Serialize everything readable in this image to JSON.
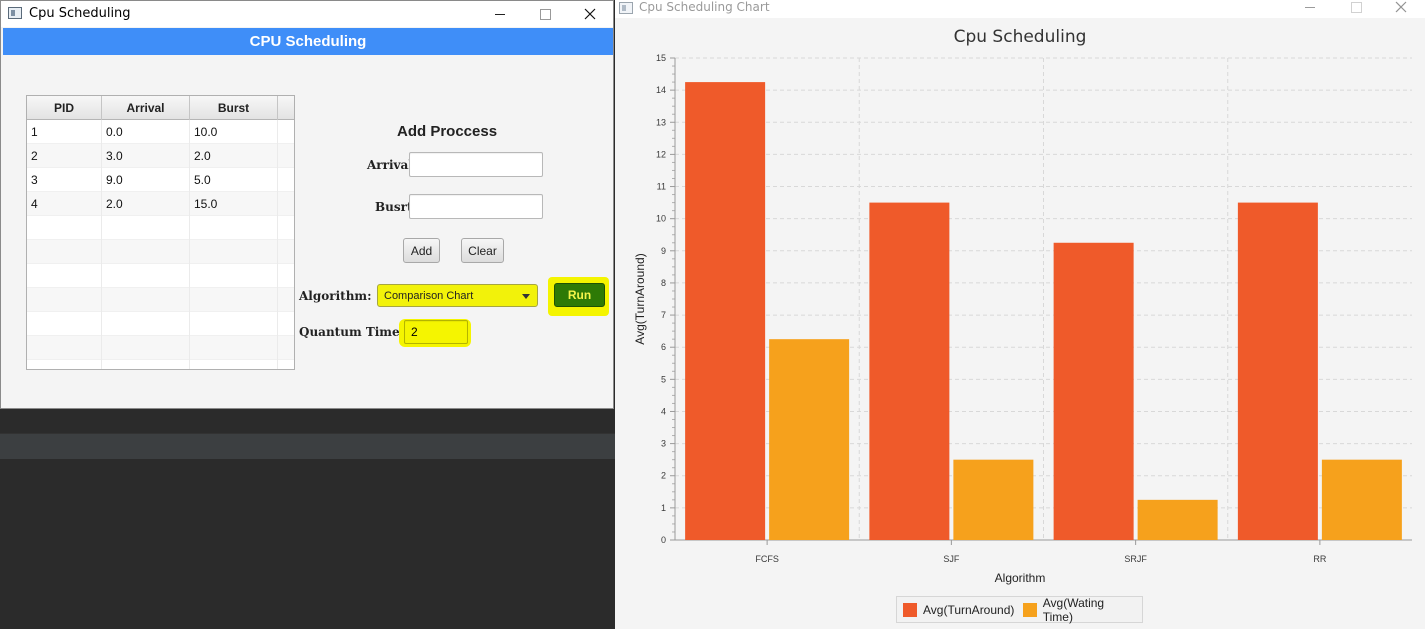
{
  "main_window": {
    "title": "Cpu Scheduling",
    "banner": "CPU Scheduling",
    "table": {
      "columns": [
        "PID",
        "Arrival",
        "Burst"
      ],
      "rows": [
        [
          "1",
          "0.0",
          "10.0"
        ],
        [
          "2",
          "3.0",
          "2.0"
        ],
        [
          "3",
          "9.0",
          "5.0"
        ],
        [
          "4",
          "2.0",
          "15.0"
        ]
      ]
    },
    "form": {
      "heading": "Add Proccess",
      "arrival_label": "Arrival:",
      "arrival_value": "",
      "burst_label": "Busrt:",
      "burst_value": "",
      "add_label": "Add",
      "clear_label": "Clear",
      "algorithm_label": "Algorithm:",
      "algorithm_selected": "Comparison Chart",
      "run_label": "Run",
      "quantum_label": "Quantum Time:",
      "quantum_value": "2"
    }
  },
  "chart_window": {
    "title": "Cpu Scheduling Chart"
  },
  "colors": {
    "turnaround": "#ef5a2a",
    "waiting": "#f6a11c",
    "banner": "#3f8ef8",
    "highlight": "#f4f400",
    "run_button": "#2e7a06"
  },
  "chart_data": {
    "type": "bar",
    "title": "Cpu Scheduling",
    "xlabel": "Algorithm",
    "ylabel": "Avg(TurnAround)",
    "categories": [
      "FCFS",
      "SJF",
      "SRJF",
      "RR"
    ],
    "series": [
      {
        "name": "Avg(TurnAround)",
        "values": [
          14.25,
          10.5,
          9.25,
          10.5
        ]
      },
      {
        "name": "Avg(Wating Time)",
        "values": [
          6.25,
          2.5,
          1.25,
          2.5
        ]
      }
    ],
    "ylim": [
      0,
      15
    ],
    "yticks": [
      "0",
      "1",
      "2",
      "3",
      "4",
      "5",
      "6",
      "7",
      "8",
      "9",
      "10",
      "11",
      "12",
      "13",
      "14",
      "15"
    ],
    "grid": true,
    "legend_position": "bottom"
  }
}
